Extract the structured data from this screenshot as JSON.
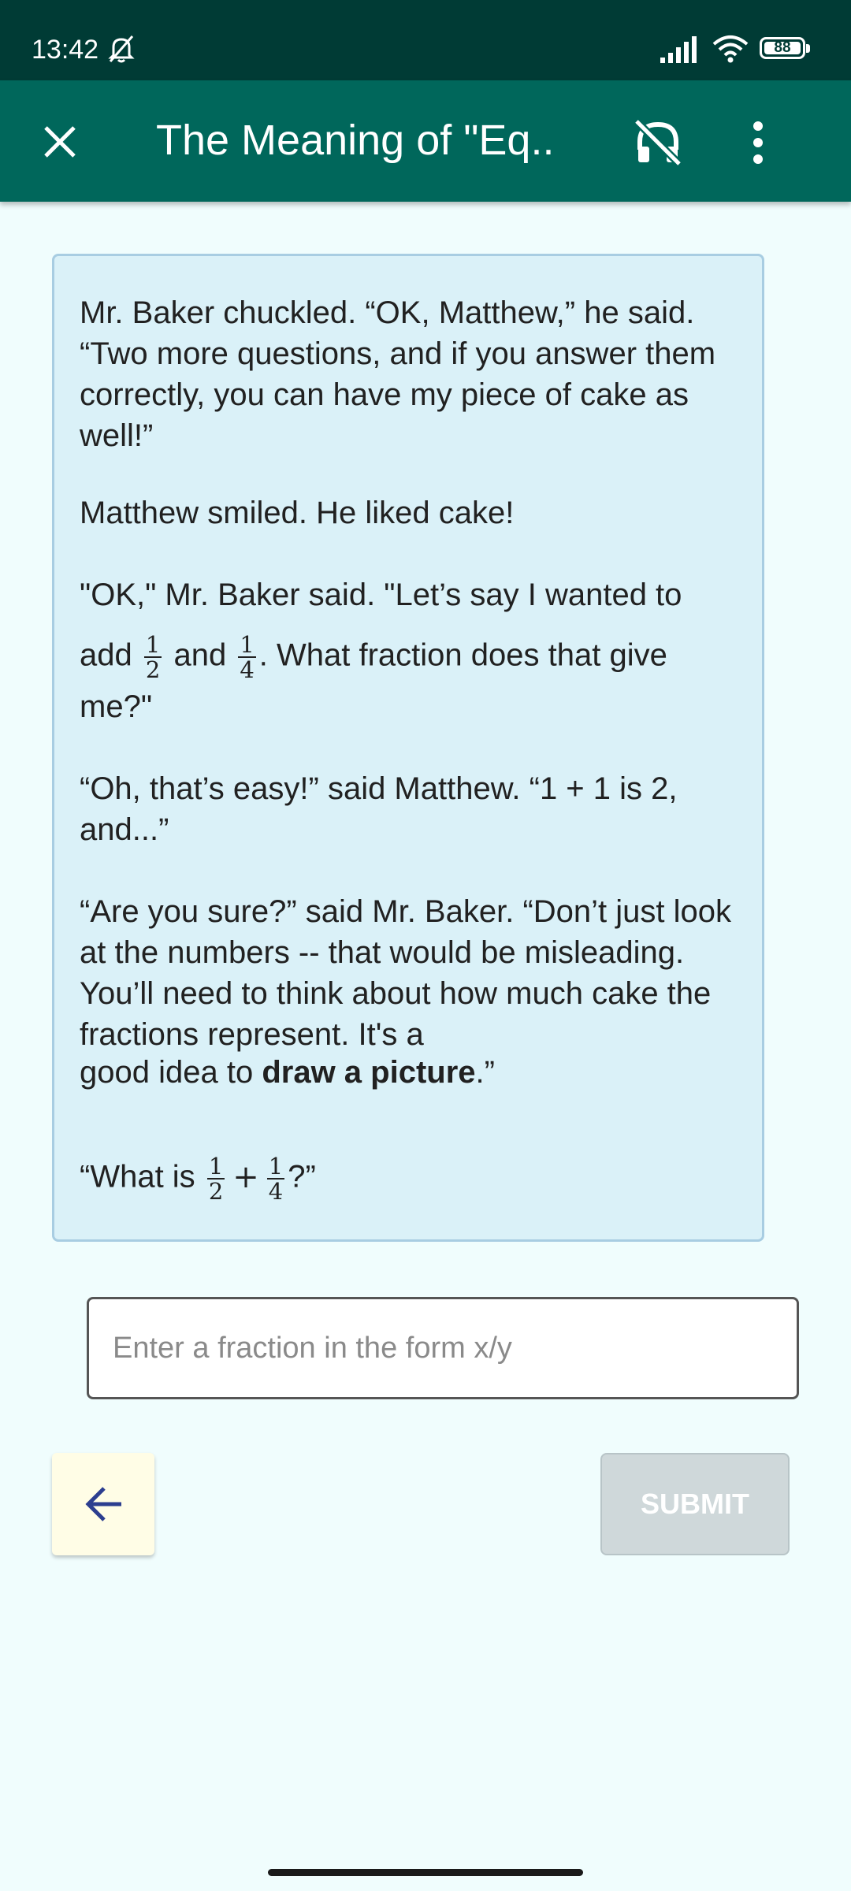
{
  "status_bar": {
    "time": "13:42",
    "battery": "88",
    "icons": [
      "bell-muted-icon",
      "signal-icon",
      "wifi-icon",
      "battery-icon"
    ]
  },
  "app_bar": {
    "title": "The Meaning of \"Eq..",
    "icons": [
      "close-icon",
      "audio-off-icon",
      "more-vert-icon"
    ]
  },
  "story": {
    "p1": "Mr. Baker chuckled. “OK, Matthew,” he said. “Two more questions, and if you answer them correctly, you can have my piece of cake as well!”",
    "p2": "Matthew smiled. He liked cake!",
    "p3a": "\"OK,\" Mr. Baker said. \"Let’s say I wanted to",
    "p3b_1": "add",
    "p3b_2": "and",
    "p3b_3": ". What fraction does that give",
    "p3c": "me?\"",
    "p4": "“Oh, that’s easy!” said Matthew. “1 + 1 is 2, and...”",
    "p5": "“Are you sure?” said Mr. Baker. “Don’t just look at the numbers -- that would be misleading. You’ll need to think about how much cake the fractions represent. It's a",
    "p5_end_pre": "good idea to",
    "p5_bold": "draw a picture",
    "p5_end_post": ".”",
    "p6_pre": "“What is",
    "p6_post": "?”",
    "frac_half": {
      "num": "1",
      "den": "2"
    },
    "frac_quarter": {
      "num": "1",
      "den": "4"
    },
    "plus": "+"
  },
  "answer": {
    "value": "",
    "placeholder": "Enter a fraction in the form x/y"
  },
  "buttons": {
    "submit": "SUBMIT",
    "back_icon": "arrow-left-icon"
  },
  "colors": {
    "status_bar": "#003b35",
    "app_bar": "#00675b",
    "background": "#f0fdfd",
    "card": "#daf1f8",
    "submit_disabled": "#cfd8da",
    "back_button": "#fffde6",
    "back_arrow": "#2c3e8f"
  }
}
